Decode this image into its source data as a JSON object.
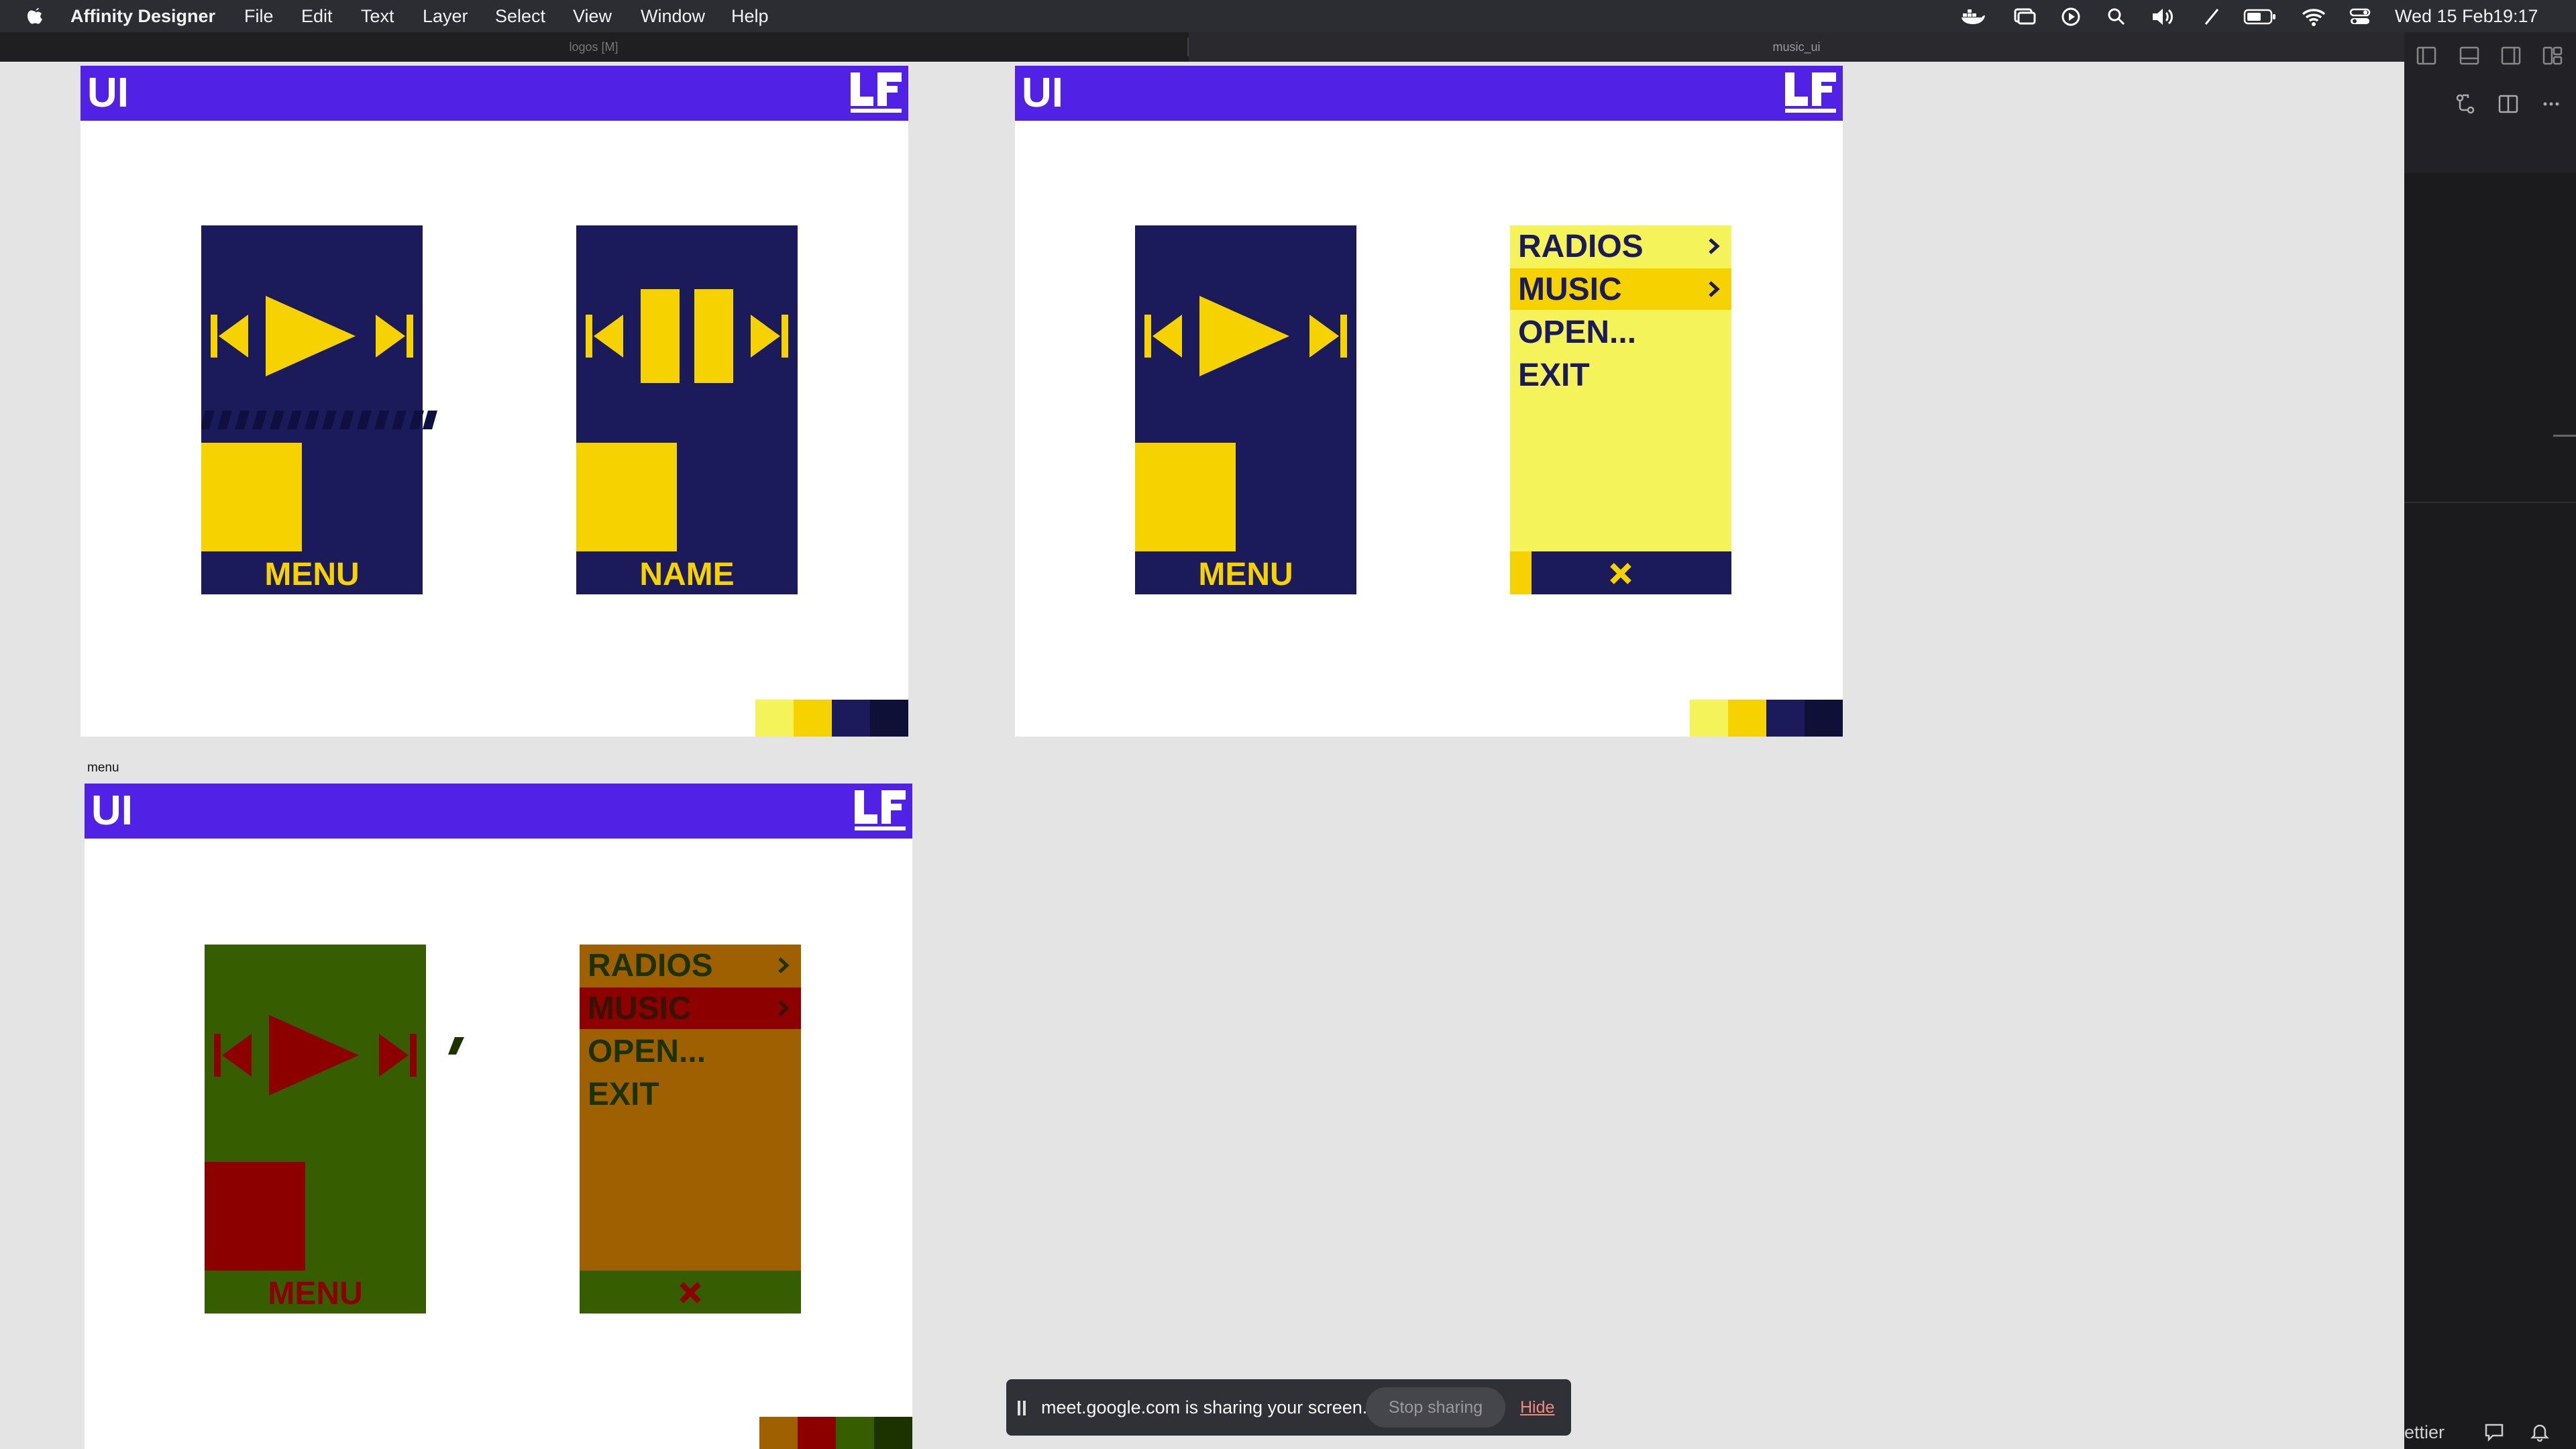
{
  "menubar": {
    "app_name": "Affinity Designer",
    "menus": [
      "File",
      "Edit",
      "Text",
      "Layer",
      "Select",
      "View",
      "Window",
      "Help"
    ],
    "date": "Wed 15 Feb",
    "time": "19:17"
  },
  "tabs": [
    {
      "label": "logos [M]"
    },
    {
      "label": "music_ui"
    }
  ],
  "colors": {
    "header": "#5121e6",
    "navy": "#1b1b5c",
    "yellow": "#f6d200",
    "pale_yellow": "#f5f35a",
    "dark_navy": "#0e1038",
    "green": "#365e00",
    "red": "#8c0000",
    "orange": "#9e6000",
    "dark_green": "#1c3300"
  },
  "artboards": [
    {
      "title": "UI",
      "cards": [
        {
          "label": "MENU"
        },
        {
          "label": "NAME"
        }
      ],
      "swatches": [
        "#f5f35a",
        "#f6d200",
        "#1b1b5c",
        "#0e1038"
      ]
    },
    {
      "title": "UI",
      "cards": [
        {
          "label": "MENU"
        }
      ],
      "menu": {
        "items": [
          "RADIOS",
          "MUSIC",
          "OPEN...",
          "EXIT"
        ]
      },
      "swatches": [
        "#f5f35a",
        "#f6d200",
        "#1b1b5c",
        "#0e1038"
      ]
    },
    {
      "label": "menu",
      "title": "UI",
      "cards": [
        {
          "label": "MENU"
        }
      ],
      "menu": {
        "items": [
          "RADIOS",
          "MUSIC",
          "OPEN...",
          "EXIT"
        ]
      },
      "swatches": [
        "#9e6000",
        "#8c0000",
        "#365e00",
        "#1c3300"
      ]
    }
  ],
  "sidepanel": {
    "status_text": "ettier"
  },
  "notification": {
    "message": "meet.google.com is sharing your screen.",
    "stop_label": "Stop sharing",
    "hide_label": "Hide"
  }
}
